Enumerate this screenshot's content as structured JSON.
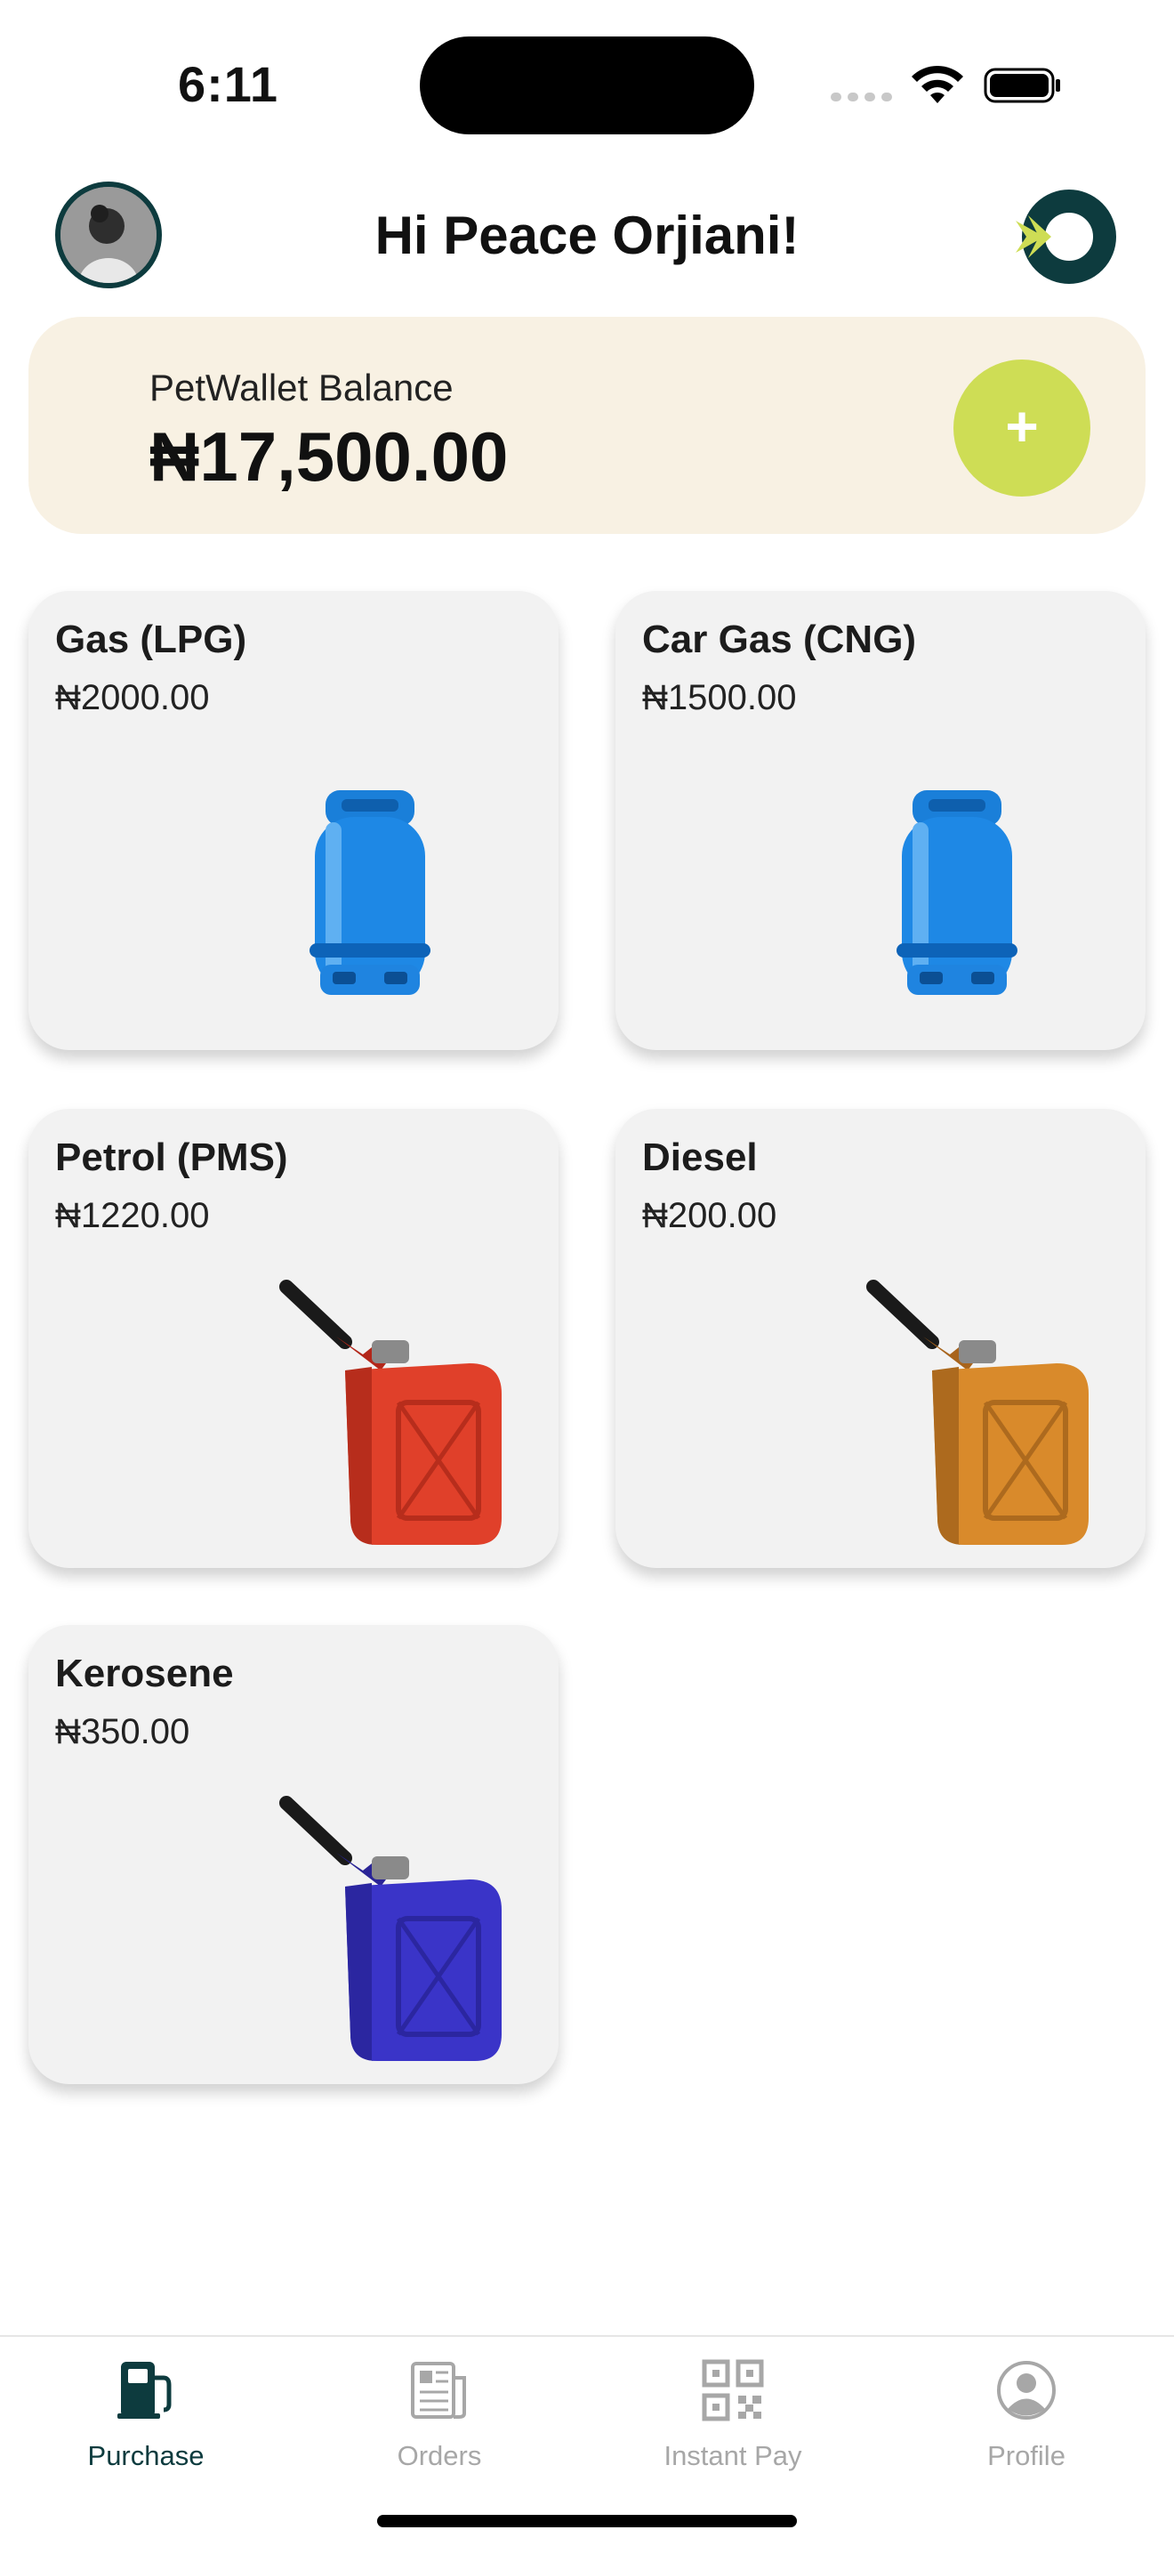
{
  "status_bar": {
    "time": "6:11"
  },
  "header": {
    "greeting": "Hi Peace Orjiani!"
  },
  "wallet": {
    "label": "PetWallet Balance",
    "amount": "₦17,500.00",
    "add_label": "+"
  },
  "products": [
    {
      "name": "Gas (LPG)",
      "price": "₦2000.00",
      "icon": "gas-cylinder-icon",
      "color": "#1e88e5"
    },
    {
      "name": "Car Gas (CNG)",
      "price": "₦1500.00",
      "icon": "gas-cylinder-icon",
      "color": "#1e88e5"
    },
    {
      "name": "Petrol (PMS)",
      "price": "₦1220.00",
      "icon": "jerry-can-icon",
      "color": "#e0402a"
    },
    {
      "name": "Diesel",
      "price": "₦200.00",
      "icon": "jerry-can-icon",
      "color": "#d98a2b"
    },
    {
      "name": "Kerosene",
      "price": "₦350.00",
      "icon": "jerry-can-icon",
      "color": "#3a34c8"
    }
  ],
  "tabs": [
    {
      "label": "Purchase",
      "icon": "fuel-pump-icon",
      "active": true
    },
    {
      "label": "Orders",
      "icon": "orders-icon",
      "active": false
    },
    {
      "label": "Instant Pay",
      "icon": "qr-code-icon",
      "active": false
    },
    {
      "label": "Profile",
      "icon": "profile-icon",
      "active": false
    }
  ],
  "colors": {
    "brand": "#0d3b3e",
    "accent": "#cedd55",
    "wallet_bg": "#f8f1e3",
    "card_bg": "#f2f2f2"
  }
}
